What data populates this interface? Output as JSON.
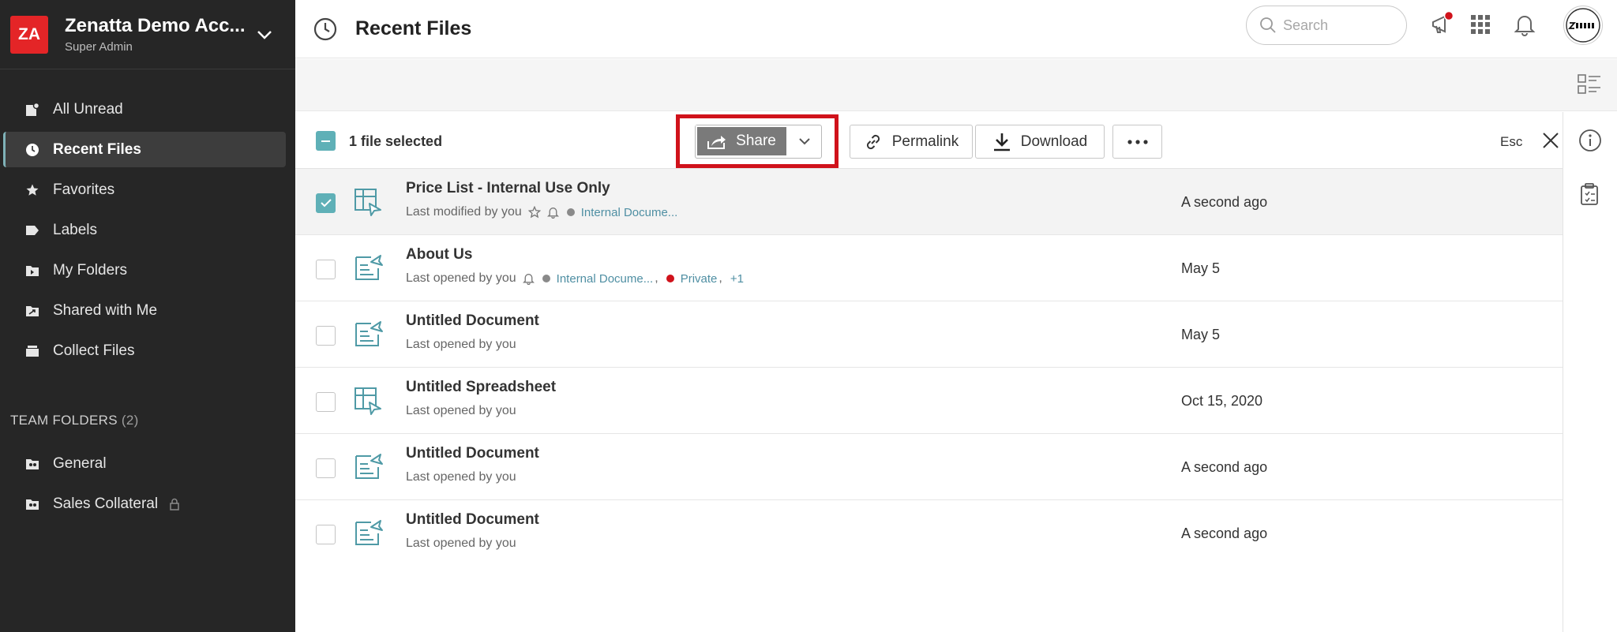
{
  "account": {
    "initials": "ZA",
    "name": "Zenatta Demo Acc...",
    "role": "Super Admin"
  },
  "sidebar": {
    "items": [
      {
        "label": "All Unread",
        "icon": "all-unread-icon"
      },
      {
        "label": "Recent Files",
        "icon": "clock-icon",
        "active": true
      },
      {
        "label": "Favorites",
        "icon": "star-icon"
      },
      {
        "label": "Labels",
        "icon": "label-icon"
      },
      {
        "label": "My Folders",
        "icon": "folder-icon"
      },
      {
        "label": "Shared with Me",
        "icon": "shared-folder-icon"
      },
      {
        "label": "Collect Files",
        "icon": "collect-files-icon"
      }
    ],
    "team_heading": "TEAM FOLDERS",
    "team_count": "(2)",
    "team_folders": [
      {
        "label": "General",
        "icon": "team-folder-icon"
      },
      {
        "label": "Sales Collateral",
        "icon": "team-folder-icon",
        "locked": true
      }
    ]
  },
  "header": {
    "title": "Recent Files",
    "search_placeholder": "Search"
  },
  "actionbar": {
    "selected_text": "1 file selected",
    "share_label": "Share",
    "permalink_label": "Permalink",
    "download_label": "Download",
    "esc_label": "Esc"
  },
  "files": [
    {
      "name": "Price List - Internal Use Only",
      "meta": "Last modified by you",
      "date": "A second ago",
      "type": "spreadsheet",
      "selected": true,
      "star": true,
      "bell": true,
      "tags": [
        {
          "label": "Internal Docume...",
          "color": "#8a8a8a"
        }
      ]
    },
    {
      "name": "About Us",
      "meta": "Last opened by you",
      "date": "May 5",
      "type": "document",
      "bell": true,
      "tags": [
        {
          "label": "Internal Docume...",
          "color": "#8a8a8a"
        },
        {
          "label": "Private",
          "color": "#d0121b"
        }
      ],
      "more": "+1"
    },
    {
      "name": "Untitled Document",
      "meta": "Last opened by you",
      "date": "May 5",
      "type": "document"
    },
    {
      "name": "Untitled Spreadsheet",
      "meta": "Last opened by you",
      "date": "Oct 15, 2020",
      "type": "spreadsheet"
    },
    {
      "name": "Untitled Document",
      "meta": "Last opened by you",
      "date": "A second ago",
      "type": "document"
    },
    {
      "name": "Untitled Document",
      "meta": "Last opened by you",
      "date": "A second ago",
      "type": "document"
    }
  ],
  "colors": {
    "sidebar_bg": "#262626",
    "accent_teal": "#5fb0b7",
    "brand_red": "#e42527",
    "highlight_red": "#d0121b"
  }
}
